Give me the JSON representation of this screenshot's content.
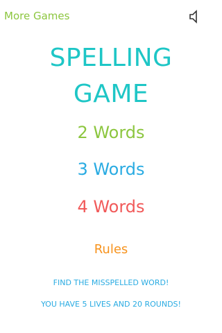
{
  "header": {
    "more_games_label": "More Games",
    "sound_icon": "speaker-icon"
  },
  "title": {
    "line1": "SPELLING",
    "line2": "GAME"
  },
  "options": [
    {
      "label": "2 Words"
    },
    {
      "label": "3 Words"
    },
    {
      "label": "4 Words"
    }
  ],
  "rules_label": "Rules",
  "info": {
    "line1": "FIND THE MISSPELLED WORD!",
    "line2": "YOU HAVE 5 LIVES AND 20 ROUNDS!"
  },
  "colors": {
    "green": "#8cc63f",
    "teal": "#1ec6c6",
    "blue": "#29abe2",
    "red": "#f15a5a",
    "orange": "#f7931e"
  }
}
